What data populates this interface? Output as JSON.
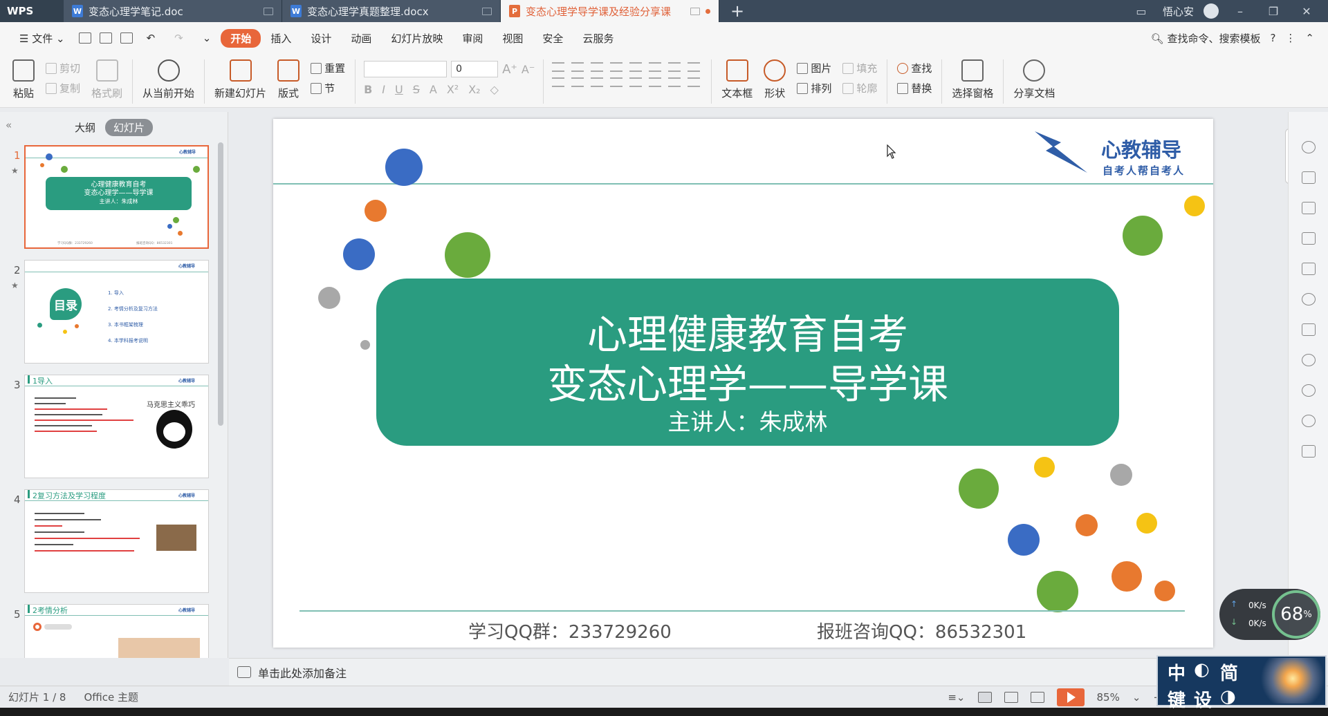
{
  "tabbar": {
    "app_name": "WPS",
    "tabs": [
      {
        "label": "变态心理学笔记.doc",
        "type": "W"
      },
      {
        "label": "变态心理学真题整理.docx",
        "type": "W"
      },
      {
        "label": "变态心理学导学课及经验分享课",
        "type": "P",
        "active": true
      }
    ],
    "user": "悟心安"
  },
  "menubar": {
    "file_label": "文件",
    "items": [
      "开始",
      "插入",
      "设计",
      "动画",
      "幻灯片放映",
      "审阅",
      "视图",
      "安全",
      "云服务"
    ],
    "active": "开始",
    "search_label": "查找命令、搜索模板"
  },
  "ribbon": {
    "paste": "粘贴",
    "cut": "剪切",
    "copy": "复制",
    "format_painter": "格式刷",
    "from_current": "从当前开始",
    "new_slide": "新建幻灯片",
    "layout": "版式",
    "reset": "重置",
    "section": "节",
    "font_size": "0",
    "textbox": "文本框",
    "shape": "形状",
    "picture": "图片",
    "fill": "填充",
    "arrange": "排列",
    "outline": "轮廓",
    "find": "查找",
    "replace": "替换",
    "selection_pane": "选择窗格",
    "share": "分享文档"
  },
  "leftpanel": {
    "tab_outline": "大纲",
    "tab_slides": "幻灯片",
    "slides": [
      {
        "num": "1",
        "l1": "心理健康教育自考",
        "l2": "变态心理学——导学课",
        "l3": "主讲人：朱成林"
      },
      {
        "num": "2",
        "badge": "目录",
        "items": [
          "1. 导入",
          "2. 考情分析及复习方法",
          "3. 本书框架梳理",
          "4. 本学科报考说明"
        ]
      },
      {
        "num": "3",
        "header": "1导入",
        "side": "马克思主义乖巧"
      },
      {
        "num": "4",
        "header": "2复习方法及学习程度"
      },
      {
        "num": "5",
        "header": "2考情分析"
      }
    ],
    "footer_qq": "学习QQ群：233729260",
    "footer_consult": "报班咨询QQ：86532301"
  },
  "slide": {
    "line1": "心理健康教育自考",
    "line2": "变态心理学——导学课",
    "line3": "主讲人：朱成林",
    "logo_main": "心教辅导",
    "logo_sub": "自考人帮自考人",
    "footer_left": "学习QQ群：233729260",
    "footer_right": "报班咨询QQ：86532301",
    "colors": {
      "teal": "#2a9c80",
      "blue": "#3a6cc4",
      "green": "#6aab3d",
      "orange": "#e8792f",
      "yellow": "#f5c314",
      "gray": "#a8a8a8"
    }
  },
  "notes": {
    "placeholder": "单击此处添加备注"
  },
  "statusbar": {
    "slide_info": "幻灯片 1 / 8",
    "theme": "Office 主题",
    "zoom": "85%"
  },
  "netmeter": {
    "up": "0K/s",
    "down": "0K/s",
    "percent": "68"
  },
  "ime": {
    "chars": [
      "中",
      "◐",
      "简",
      "键",
      "设",
      "◑"
    ]
  }
}
